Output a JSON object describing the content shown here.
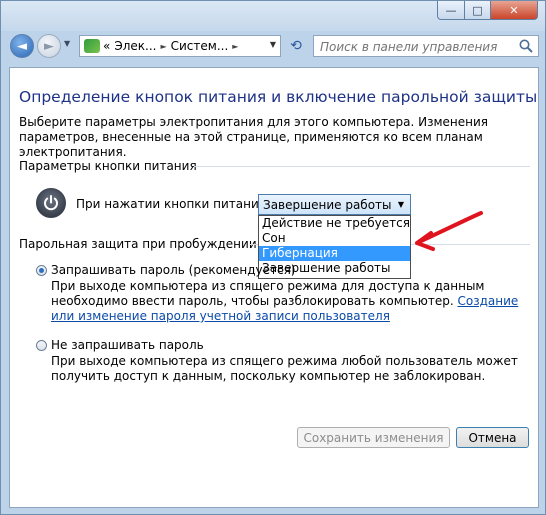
{
  "window": {
    "min_glyph": "—",
    "max_glyph": "□",
    "close_glyph": "✕"
  },
  "nav": {
    "back_glyph": "◄",
    "forward_glyph": "►",
    "address_chevron": "«",
    "breadcrumbs": [
      "Элек...",
      "Систем..."
    ],
    "search_placeholder": "Поиск в панели управления"
  },
  "page": {
    "title": "Определение кнопок питания и включение парольной защиты",
    "intro": "Выберите параметры электропитания для этого компьютера. Изменения параметров, внесенные на этой странице, применяются ко всем планам электропитания.",
    "power_section_label": "Параметры кнопки питания",
    "power_button_label": "При нажатии кнопки питания:",
    "power_select_value": "Завершение работы",
    "power_options": [
      {
        "label": "Действие не требуется",
        "highlighted": false
      },
      {
        "label": "Сон",
        "highlighted": false
      },
      {
        "label": "Гибернация",
        "highlighted": true
      },
      {
        "label": "Завершение работы",
        "highlighted": false
      }
    ],
    "wake_section_label": "Парольная защита при пробуждении",
    "require_password": {
      "label": "Запрашивать пароль (рекомендуется)",
      "selected": true,
      "description": "При выходе компьютера из спящего режима для доступа к данным необходимо ввести пароль, чтобы разблокировать компьютер.",
      "link": "Создание или изменение пароля учетной записи пользователя"
    },
    "no_password": {
      "label": "Не запрашивать пароль",
      "selected": false,
      "description": "При выходе компьютера из спящего режима любой пользователь может получить доступ к данным, поскольку компьютер не заблокирован."
    },
    "save_button": "Сохранить изменения",
    "cancel_button": "Отмена"
  },
  "colors": {
    "title": "#1e3287",
    "link": "#0b4aa8",
    "highlight": "#3399ff",
    "annotation_arrow": "#e0141e"
  }
}
